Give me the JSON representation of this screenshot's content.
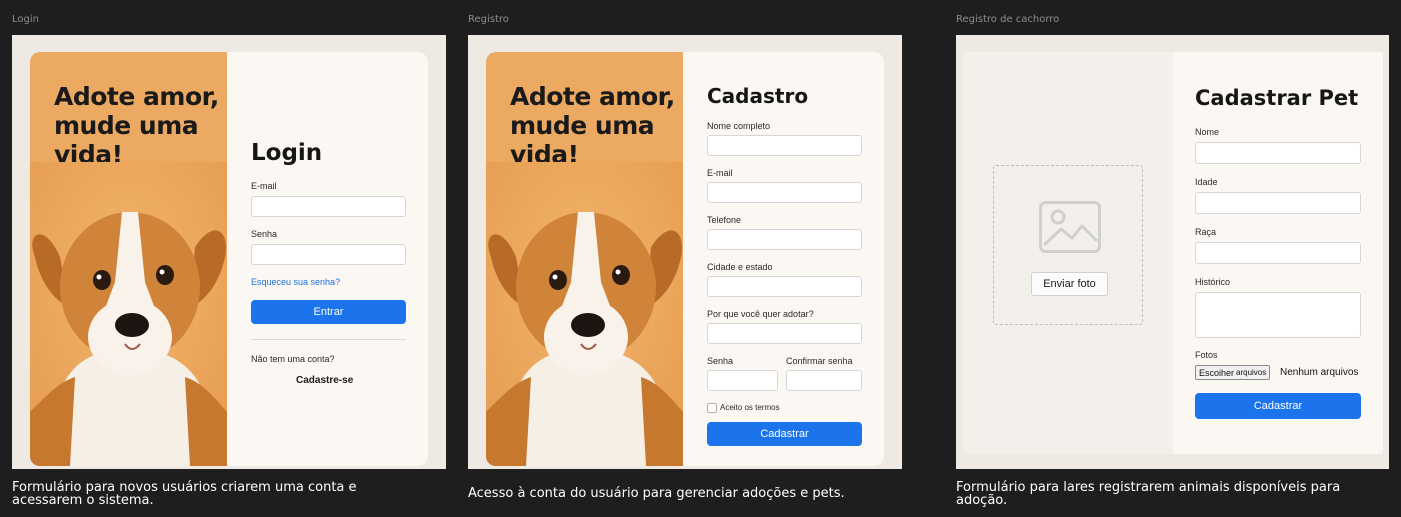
{
  "frames": [
    {
      "label": "Login",
      "caption": [
        "Formulário para novos usuários criarem uma conta e",
        "acessarem o sistema."
      ],
      "hero": {
        "lines": [
          "Adote amor,",
          "mude uma",
          "vida!"
        ]
      },
      "form": {
        "title": "Login",
        "email_label": "E-mail",
        "password_label": "Senha",
        "forgot_link": "Esqueceu sua senha?",
        "submit": "Entrar",
        "no_account": "Não tem uma conta?",
        "signup_link": "Cadastre-se"
      }
    },
    {
      "label": "Registro",
      "caption": "Acesso à conta do usuário para gerenciar adoções e pets.",
      "hero": {
        "lines": [
          "Adote amor,",
          "mude uma",
          "vida!"
        ]
      },
      "form": {
        "title": "Cadastro",
        "name_label": "Nome completo",
        "email_label": "E-mail",
        "phone_label": "Telefone",
        "city_label": "Cidade e estado",
        "reason_label": "Por que você quer adotar?",
        "password_label": "Senha",
        "confirm_label": "Confirmar senha",
        "terms_label": "Aceito os termos",
        "submit": "Cadastrar"
      }
    },
    {
      "label": "Registro de cachorro",
      "caption": [
        "Formulário para lares registrarem animais disponíveis para",
        "adoção."
      ],
      "upload": {
        "button": "Enviar foto"
      },
      "form": {
        "title": "Cadastrar Pet",
        "name_label": "Nome",
        "age_label": "Idade",
        "breed_label": "Raça",
        "history_label": "Histórico",
        "photos_label": "Fotos",
        "file_button": "Escoiher",
        "file_button_suffix": "arquivos",
        "file_status": "Nenhum arquivos",
        "submit": "Cadastrar"
      }
    }
  ],
  "colors": {
    "background": "#1e1e1e",
    "frame": "#efe9e4",
    "hero": "#eba961",
    "primary": "#1c74ec",
    "link": "#1c6fdc"
  }
}
